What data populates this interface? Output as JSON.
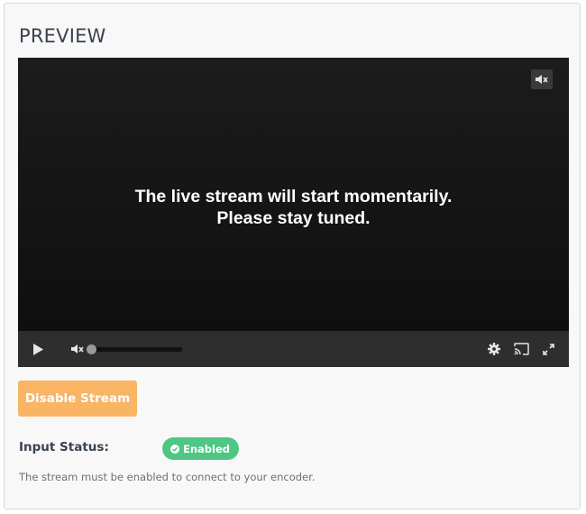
{
  "section": {
    "title": "PREVIEW"
  },
  "player": {
    "message_line1": "The live stream will start momentarily.",
    "message_line2": "Please stay tuned.",
    "volume_level": 0,
    "muted": true,
    "icons": {
      "corner": "volume-mute-icon",
      "play": "play-icon",
      "volume": "volume-mute-icon",
      "settings": "gear-icon",
      "cast": "cast-icon",
      "fullscreen": "fullscreen-icon"
    }
  },
  "actions": {
    "disable_label": "Disable Stream"
  },
  "input_status": {
    "label": "Input Status:",
    "badge": "Enabled",
    "badge_icon": "check-circle-icon",
    "note": "The stream must be enabled to connect to your encoder."
  },
  "colors": {
    "disable_button": "#f9b464",
    "status_badge": "#4fc684",
    "heading_text": "#39424e"
  }
}
